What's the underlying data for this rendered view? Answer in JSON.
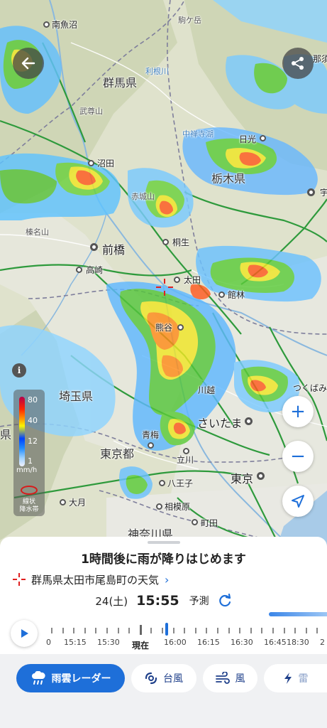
{
  "map": {
    "places": {
      "minami_uonuma": "南魚沼",
      "gunma_pref": "群馬県",
      "tochigi_pref": "栃木県",
      "saitama_pref": "埼玉県",
      "tokyo_to": "東京都",
      "kanagawa_pref": "神奈川県",
      "numata": "沼田",
      "nikko": "日光",
      "utsunomiya": "宇",
      "maebashi": "前橋",
      "takasaki": "高崎",
      "kiryu": "桐生",
      "ota": "太田",
      "tatebayashi": "館林",
      "kumagaya": "熊谷",
      "kawagoe": "川越",
      "saitama": "さいたま",
      "tsukuba": "つくばみ",
      "ome": "青梅",
      "tachikawa": "立川",
      "tokyo": "東京",
      "hachioji": "八王子",
      "sagamihara": "相模原",
      "machida": "町田",
      "otsuki": "大月",
      "nasu": "那須",
      "chuzenji": "中禅寺湖",
      "haruna": "榛名山",
      "komagatake": "駒ケ岳",
      "tanigawa": "武尊山",
      "akagi": "赤城山",
      "edge_pref": "県",
      "sanba": "湯",
      "tonegawa": "利根川",
      "misc": "荒"
    },
    "legend": {
      "labels": [
        "80",
        "40",
        "12",
        "4",
        "1"
      ],
      "unit": "mm/h",
      "band_label_1": "線状",
      "band_label_2": "降水帯"
    },
    "info_icon": "info-icon",
    "back_icon": "back-arrow-icon",
    "share_icon": "share-icon",
    "zoom_in": "+",
    "zoom_out": "−",
    "location_icon": "navigation-arrow-icon"
  },
  "sheet": {
    "headline": "1時間後に雨が降りはじめます",
    "location": "群馬県太田市尾島町の天気",
    "date": "24(土)",
    "time": "15:55",
    "mode": "予測",
    "timeline": {
      "labels": [
        "0",
        "15:15",
        "15:30",
        "現在",
        "16:00",
        "16:15",
        "16:30",
        "16:45",
        "18:30",
        "2"
      ],
      "progress_fraction": 0.18
    }
  },
  "tabs": [
    {
      "label": "雨雲レーダー",
      "icon": "rain-cloud-icon",
      "active": true
    },
    {
      "label": "台風",
      "icon": "typhoon-icon",
      "active": false
    },
    {
      "label": "風",
      "icon": "wind-icon",
      "active": false
    },
    {
      "label": "雷",
      "icon": "lightning-icon",
      "active": false
    }
  ]
}
